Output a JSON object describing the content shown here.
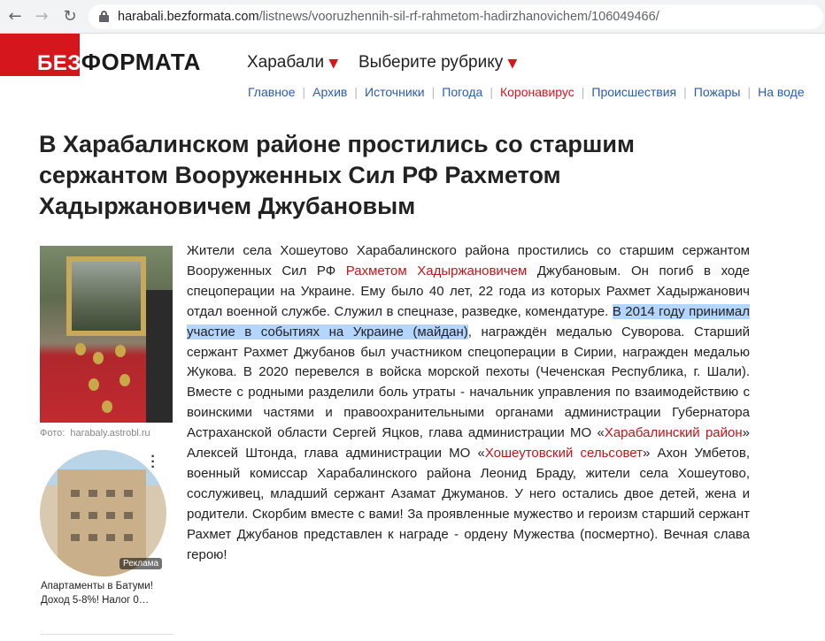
{
  "browser": {
    "back_icon": "arrow-left-icon",
    "forward_icon": "arrow-right-icon",
    "reload_icon": "reload-icon",
    "url_host": "harabali.bezformata.com",
    "url_path": "/listnews/vooruzhennih-sil-rf-rahmetom-hadirzhanovichem/106049466/"
  },
  "site": {
    "logo_prefix": "БЕЗ",
    "logo_main": "ФОРМАТА",
    "region": "Харабали",
    "rubric": "Выберите рубрику",
    "nav": [
      "Главное",
      "Архив",
      "Источники",
      "Погода",
      "Коронавирус",
      "Происшествия",
      "Пожары",
      "На воде"
    ],
    "accent_color": "#d5161c",
    "link_color": "#2a5db0"
  },
  "article": {
    "title": "В Харабалинском районе простились со старшим сержантом Вооруженных Сил РФ Рахметом Хадыржановичем Джубановым",
    "photo_caption_label": "Фото:",
    "photo_caption_source": "harabaly.astrobl.ru",
    "body": {
      "p1": "Жители села Хошеутово Харабалинского района простились со старшим сержантом Вооруженных Сил РФ ",
      "link1": "Рахметом Хадыржановичем",
      "p2": " Джубановым. Он погиб в ходе спецоперации на Украине. Ему было 40 лет, 22 года из которых Рахмет Хадыржанович отдал военной службе. Служил в спецназе, разведке, комендатуре.    ",
      "highlight": "В 2014 году принимал участие в событиях на Украине (майдан)",
      "p3": ", награждён медалью Суворова. Старший сержант  Рахмет Джубанов был участником спецоперации в Сирии,  награжден медалью Жукова. В 2020  перевелся в войска морской пехоты (Чеченская Республика, г. Шали).    Вместе с родными разделили боль утраты - начальник управления по взаимодействию с воинскими частями и правоохранительными органами администрации Губернатора Астраханской области Сергей Яцков, глава администрации МО «",
      "link2": "Харабалинский район",
      "p4": "»     Алексей Штонда, глава администрации МО «",
      "link3": "Хошеутовский сельсовет",
      "p5": "» Ахон Умбетов, военный комиссар Харабалинского района Леонид Браду, жители села Хошеутово, сослуживец, младший сержант Азамат Джуманов.     У него остались двое детей, жена и родители. Скорбим вместе с вами!   За проявленные мужество и героизм старший сержант Рахмет Джубанов представлен  к награде -   ордену Мужества (посмертно). Вечная слава герою!"
    }
  },
  "ad": {
    "badge": "Реклама",
    "title": "Апартаменты в Батуми! Доход 5-8%! Налог 0…",
    "menu_icon": "more-vertical-icon"
  }
}
